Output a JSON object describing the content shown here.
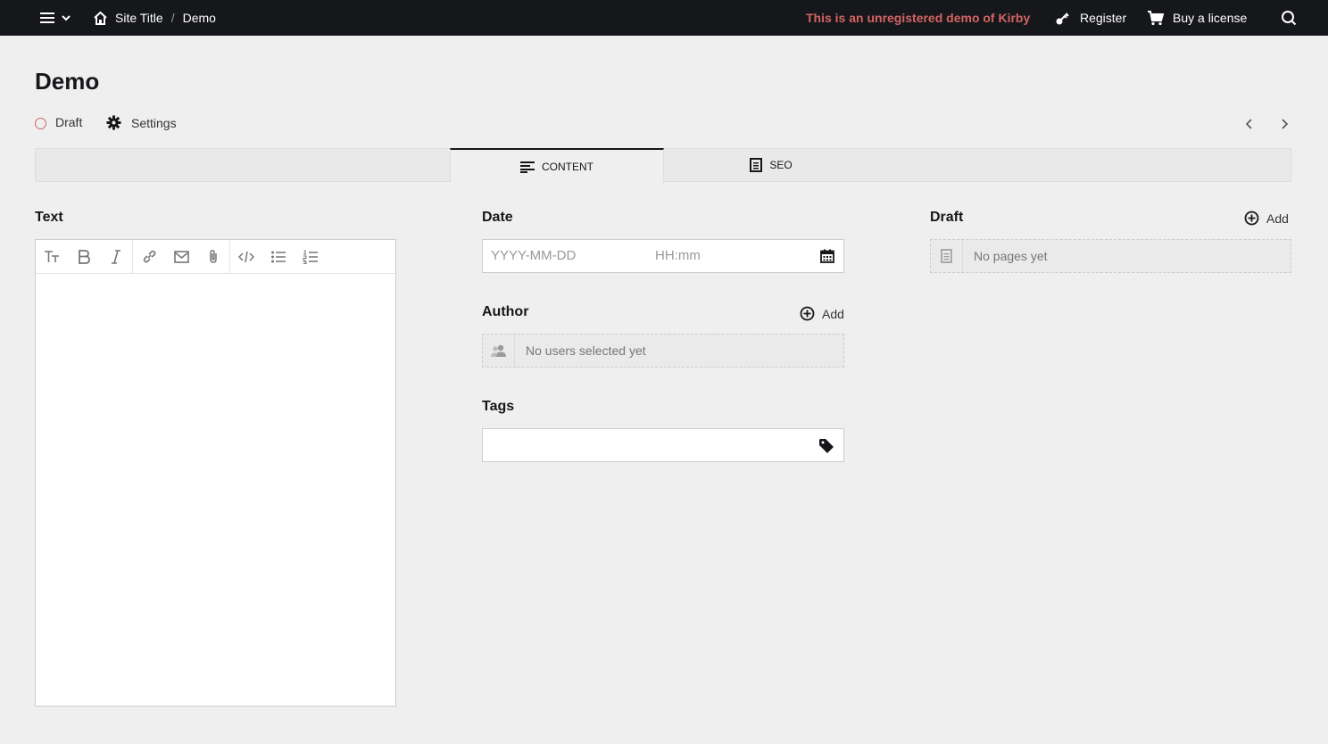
{
  "topbar": {
    "breadcrumb": [
      "Site Title",
      "Demo"
    ],
    "unregistered": "This is an unregistered demo of Kirby",
    "register_label": "Register",
    "buy_label": "Buy a license"
  },
  "page": {
    "title": "Demo",
    "status": "Draft",
    "settings_label": "Settings"
  },
  "tabs": [
    {
      "label": "CONTENT",
      "icon": "text-lines-icon",
      "active": true
    },
    {
      "label": "SEO",
      "icon": "page-icon",
      "active": false
    }
  ],
  "fields": {
    "text": {
      "label": "Text"
    },
    "date": {
      "label": "Date",
      "date_placeholder": "YYYY-MM-DD",
      "time_placeholder": "HH:mm"
    },
    "author": {
      "label": "Author",
      "add_label": "Add",
      "empty": "No users selected yet"
    },
    "tags": {
      "label": "Tags"
    },
    "draft": {
      "label": "Draft",
      "add_label": "Add",
      "empty": "No pages yet"
    }
  },
  "colors": {
    "topbar": "#16171a",
    "background": "#efefef",
    "warning": "#d16464"
  }
}
